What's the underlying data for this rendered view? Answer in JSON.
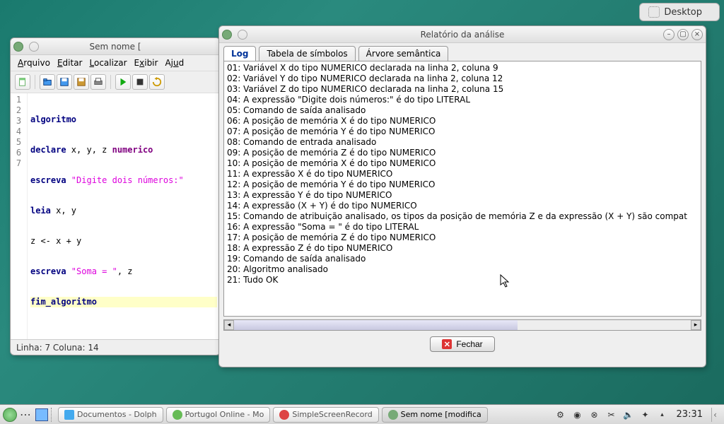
{
  "desktop": {
    "label": "Desktop"
  },
  "editor": {
    "title": "Sem nome [",
    "menu": {
      "file": "Arquivo",
      "edit": "Editar",
      "find": "Localizar",
      "view": "Exibir",
      "help": "Ajud"
    },
    "lines": [
      1,
      2,
      3,
      4,
      5,
      6,
      7
    ],
    "code": {
      "l1_kw": "algoritmo",
      "l2_kw": "declare",
      "l2_ids": " x, y, z ",
      "l2_type": "numerico",
      "l3_kw": "escreva",
      "l3_str": " \"Digite dois números:\"",
      "l4_kw": "leia",
      "l4_rest": " x, y",
      "l5": "z <- x + y",
      "l6_kw": "escreva",
      "l6_str": " \"Soma = \"",
      "l6_rest": ", z",
      "l7_kw": "fim_algoritmo"
    },
    "status": "Linha: 7 Coluna: 14"
  },
  "analysis": {
    "title": "Relatório da análise",
    "tabs": {
      "log": "Log",
      "symbols": "Tabela de símbolos",
      "semantic": "Árvore semântica"
    },
    "log": [
      "01: Variável X do tipo NUMERICO declarada na linha 2, coluna 9",
      "02: Variável Y do tipo NUMERICO declarada na linha 2, coluna 12",
      "03: Variável Z do tipo NUMERICO declarada na linha 2, coluna 15",
      "04: A expressão \"Digite dois números:\" é do tipo LITERAL",
      "05: Comando de saída analisado",
      "06: A posição de memória X é do tipo NUMERICO",
      "07: A posição de memória Y é do tipo NUMERICO",
      "08: Comando de entrada analisado",
      "09: A posição de memória Z é do tipo NUMERICO",
      "10: A posição de memória X é do tipo NUMERICO",
      "11: A expressão X é do tipo NUMERICO",
      "12: A posição de memória Y é do tipo NUMERICO",
      "13: A expressão Y é do tipo NUMERICO",
      "14: A expressão (X + Y) é do tipo NUMERICO",
      "15: Comando de atribuição analisado, os tipos da posição de memória Z e da expressão (X + Y) são compat",
      "16: A expressão \"Soma = \" é do tipo LITERAL",
      "17: A posição de memória Z é do tipo NUMERICO",
      "18: A expressão Z é do tipo NUMERICO",
      "19: Comando de saída analisado",
      "20: Algoritmo analisado",
      "21: Tudo OK"
    ],
    "close": "Fechar"
  },
  "taskbar": {
    "tasks": [
      {
        "label": "Documentos - Dolph"
      },
      {
        "label": "Portugol Online - Mo"
      },
      {
        "label": "SimpleScreenRecord"
      },
      {
        "label": "Sem nome [modifica"
      }
    ],
    "clock": "23:31"
  }
}
